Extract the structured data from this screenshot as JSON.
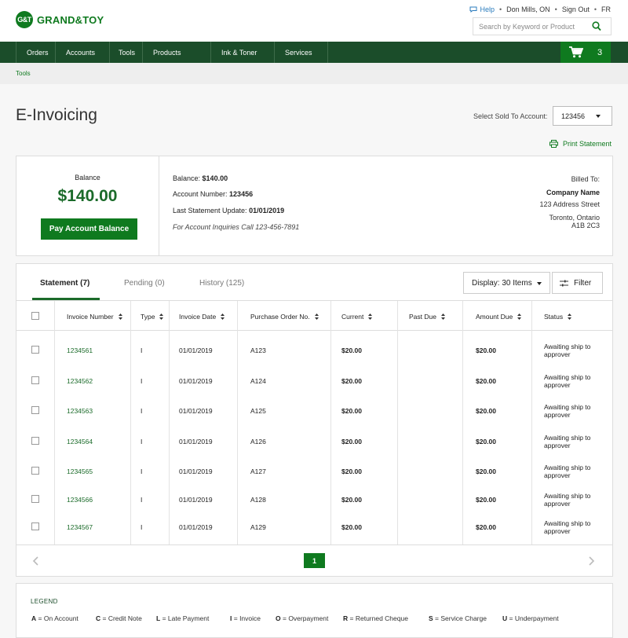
{
  "brand": {
    "mark": "G&T",
    "name": "GRAND&TOY"
  },
  "utility": {
    "help": "Help",
    "location": "Don Mills, ON",
    "signout": "Sign Out",
    "lang": "FR"
  },
  "search": {
    "placeholder": "Search by Keyword or Product"
  },
  "nav": [
    "Orders",
    "Accounts",
    "Tools",
    "Products",
    "Ink & Toner",
    "Services"
  ],
  "cart": {
    "count": "3"
  },
  "breadcrumb": "Tools",
  "page_title": "E-Invoicing",
  "sold_to": {
    "label": "Select Sold To Account:",
    "value": "123456"
  },
  "print_label": "Print Statement",
  "summary": {
    "balance_label": "Balance",
    "balance_amount": "$140.00",
    "pay_button": "Pay Account Balance",
    "balance_line_label": "Balance:",
    "balance_line_value": "$140.00",
    "account_label": "Account Number:",
    "account_value": "123456",
    "last_update_label": "Last Statement Update:",
    "last_update_value": "01/01/2019",
    "inquiries": "For Account Inquiries Call 123-456-7891",
    "billed_to": "Billed To:",
    "company": "Company Name",
    "address1": "123 Address Street",
    "city": "Toronto, Ontario",
    "postal": "A1B 2C3"
  },
  "tabs": [
    "Statement (7)",
    "Pending (0)",
    "History (125)"
  ],
  "display": "Display: 30 Items",
  "filter": "Filter",
  "columns": [
    "Invoice Number",
    "Type",
    "Invoice Date",
    "Purchase Order No.",
    "Current",
    "Past Due",
    "Amount Due",
    "Status"
  ],
  "rows": [
    {
      "invoice": "1234561",
      "type": "I",
      "date": "01/01/2019",
      "po": "A123",
      "current": "$20.00",
      "past_due": "",
      "amount": "$20.00",
      "status": "Awaiting ship to approver"
    },
    {
      "invoice": "1234562",
      "type": "I",
      "date": "01/01/2019",
      "po": "A124",
      "current": "$20.00",
      "past_due": "",
      "amount": "$20.00",
      "status": "Awaiting ship to approver"
    },
    {
      "invoice": "1234563",
      "type": "I",
      "date": "01/01/2019",
      "po": "A125",
      "current": "$20.00",
      "past_due": "",
      "amount": "$20.00",
      "status": "Awaiting ship to approver"
    },
    {
      "invoice": "1234564",
      "type": "I",
      "date": "01/01/2019",
      "po": "A126",
      "current": "$20.00",
      "past_due": "",
      "amount": "$20.00",
      "status": "Awaiting ship to approver"
    },
    {
      "invoice": "1234565",
      "type": "I",
      "date": "01/01/2019",
      "po": "A127",
      "current": "$20.00",
      "past_due": "",
      "amount": "$20.00",
      "status": "Awaiting ship to approver"
    },
    {
      "invoice": "1234566",
      "type": "I",
      "date": "01/01/2019",
      "po": "A128",
      "current": "$20.00",
      "past_due": "",
      "amount": "$20.00",
      "status": "Awaiting ship to approver"
    },
    {
      "invoice": "1234567",
      "type": "I",
      "date": "01/01/2019",
      "po": "A129",
      "current": "$20.00",
      "past_due": "",
      "amount": "$20.00",
      "status": "Awaiting ship to approver"
    }
  ],
  "pagination": {
    "current_page": "1"
  },
  "legend": {
    "title": "LEGEND",
    "items": [
      {
        "code": "A",
        "label": "= On Account"
      },
      {
        "code": "C",
        "label": "= Credit Note"
      },
      {
        "code": "L",
        "label": "= Late Payment"
      },
      {
        "code": "I",
        "label": "= Invoice"
      },
      {
        "code": "O",
        "label": "= Overpayment"
      },
      {
        "code": "R",
        "label": "= Returned Cheque"
      },
      {
        "code": "S",
        "label": "= Service Charge"
      },
      {
        "code": "U",
        "label": "= Underpayment"
      }
    ]
  },
  "colors": {
    "brand_green": "#0f7a1f",
    "nav_green": "#1b4d2a",
    "link_green": "#1b6b2a",
    "help_blue": "#2a7bbd"
  }
}
